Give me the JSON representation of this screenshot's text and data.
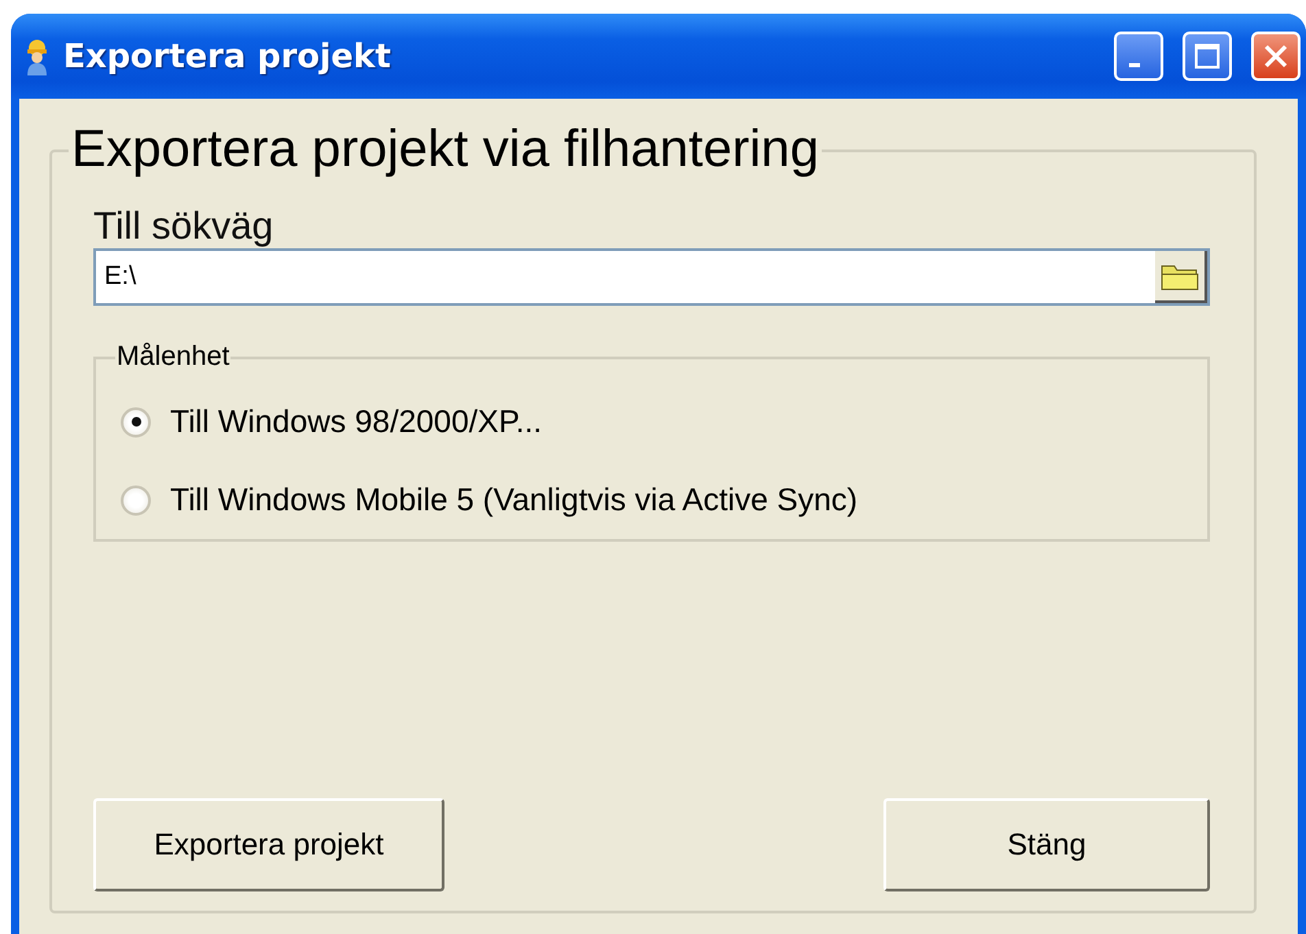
{
  "window": {
    "title": "Exportera projekt"
  },
  "group": {
    "title": "Exportera projekt via filhantering"
  },
  "path": {
    "label": "Till sökväg",
    "value": "E:\\"
  },
  "target": {
    "title": "Målenhet",
    "options": [
      {
        "label": "Till Windows 98/2000/XP...",
        "selected": true
      },
      {
        "label": "Till Windows Mobile 5 (Vanligtvis via Active Sync)",
        "selected": false
      }
    ]
  },
  "buttons": [
    "Exportera projekt",
    "Stäng"
  ]
}
